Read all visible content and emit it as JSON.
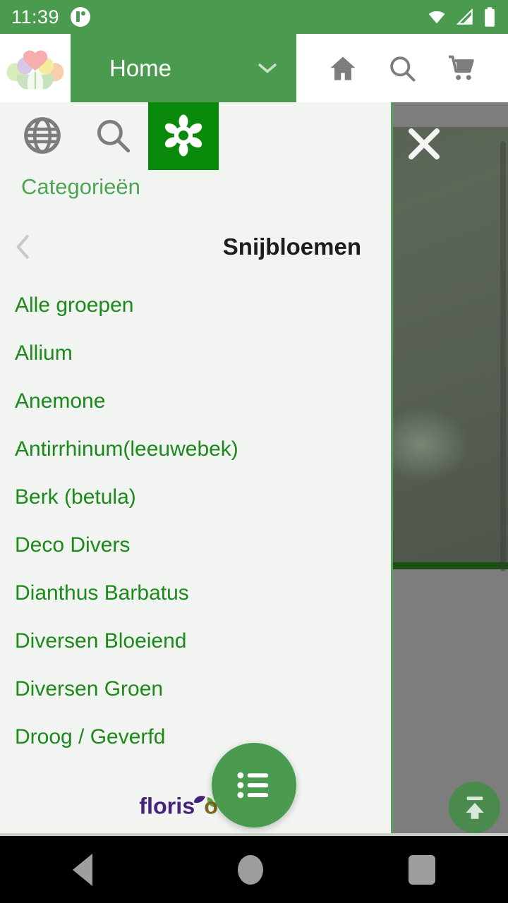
{
  "status_bar": {
    "time": "11:39",
    "notification_icon": "notification-badge-icon",
    "wifi_icon": "wifi-icon",
    "signal_icon": "cellular-signal-icon",
    "battery_icon": "battery-full-icon",
    "background_color": "#4a9b50"
  },
  "header": {
    "logo_icon": "flower-bouquet-logo",
    "location_label": "Home",
    "dropdown_icon": "chevron-down-icon",
    "actions": [
      {
        "name": "home-icon",
        "label": "Home"
      },
      {
        "name": "search-icon",
        "label": "Zoeken"
      },
      {
        "name": "cart-icon",
        "label": "Winkelwagen"
      }
    ],
    "accent_color": "#4a9b50"
  },
  "drawer": {
    "tabs": [
      {
        "id": "globe",
        "icon": "globe-icon",
        "active": false
      },
      {
        "id": "search",
        "icon": "search-icon",
        "active": false
      },
      {
        "id": "flower",
        "icon": "flower-icon",
        "active": true
      }
    ],
    "active_tab_color": "#0a8a0a",
    "section_title": "Categorieën",
    "back_icon": "chevron-left-icon",
    "current_category": "Snijbloemen",
    "items": [
      {
        "label": "Alle groepen"
      },
      {
        "label": "Allium"
      },
      {
        "label": "Anemone"
      },
      {
        "label": "Antirrhinum(leeuwebek)"
      },
      {
        "label": "Berk (betula)"
      },
      {
        "label": "Deco Divers"
      },
      {
        "label": "Dianthus Barbatus"
      },
      {
        "label": "Diversen Bloeiend"
      },
      {
        "label": "Diversen Groen"
      },
      {
        "label": "Droog / Geverfd"
      }
    ],
    "item_color": "#1b8a1b",
    "brand_name": "florisoft",
    "brand_colors": {
      "text": "#46237a",
      "leaf": "#5fa832"
    },
    "fab_icon": "list-menu-icon",
    "fab_color": "#4a9b50"
  },
  "overlay": {
    "close_icon": "close-icon"
  },
  "background_page": {
    "scroll_top_icon": "scroll-to-top-icon",
    "scroll_top_color": "#4a8a4c",
    "scrollbar": "vertical-scrollbar",
    "photo_subject": "eucalyptus-foliage-photo",
    "dim_color": "#7d7d7d"
  },
  "nav_bar": {
    "back": "back-triangle-icon",
    "home": "home-circle-icon",
    "recents": "recents-square-icon"
  }
}
